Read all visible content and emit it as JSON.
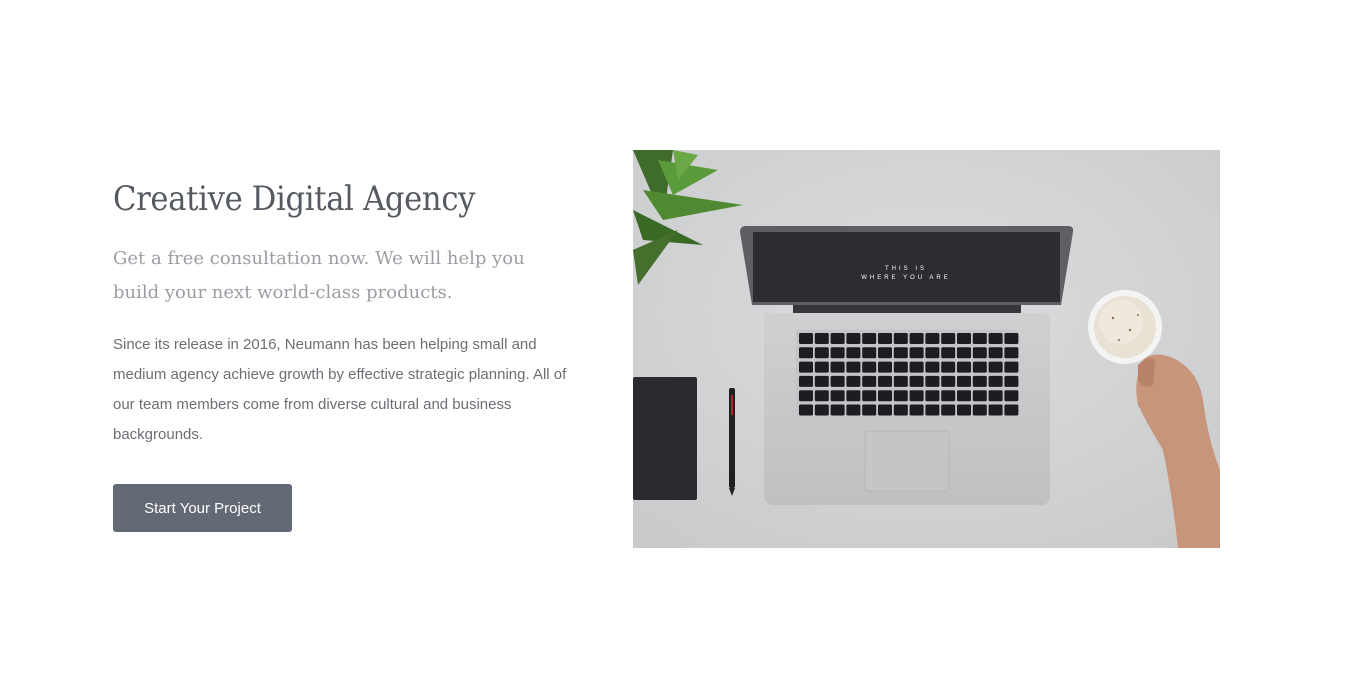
{
  "hero": {
    "title": "Creative Digital Agency",
    "subtitle": "Get a free consultation now. We will help you build your next world-class products.",
    "body": "Since its release in 2016, Neumann has been helping small and medium agency achieve growth by effective strategic planning. All of our team members come from diverse cultural and business backgrounds.",
    "cta_label": "Start Your Project"
  },
  "photo": {
    "screen_text_line1": "THIS IS",
    "screen_text_line2": "WHERE YOU ARE"
  },
  "colors": {
    "button_bg": "#626a75",
    "title": "#555a61",
    "subtitle": "#9a9ea3",
    "body": "#6b6f74"
  }
}
